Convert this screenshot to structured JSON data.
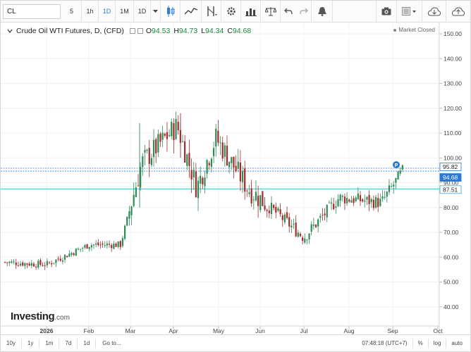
{
  "toolbar": {
    "symbol": "CL",
    "intervals": [
      "5",
      "1h",
      "1D",
      "1M",
      "1D"
    ],
    "active_interval": 2,
    "icons": [
      "dropdown-icon",
      "candles-icon",
      "indicators-icon",
      "drawing-tool-icon",
      "settings-icon",
      "chart-template-icon",
      "balance-icon",
      "undo-icon",
      "redo-icon",
      "alert-icon",
      "camera-icon",
      "window-layout-icon",
      "cloud-load-icon",
      "cloud-save-icon"
    ]
  },
  "legend": {
    "title": "Crude Oil WTI Futures, D, (CFD)",
    "o_label": "O",
    "o": "94.53",
    "h_label": "H",
    "h": "94.73",
    "l_label": "L",
    "l": "94.34",
    "c_label": "C",
    "c": "94.68",
    "status": "Market Closed"
  },
  "axis": {
    "y_ticks": [
      "150.00",
      "140.00",
      "130.00",
      "120.00",
      "110.00",
      "100.00",
      "90.00",
      "80.00",
      "70.00",
      "60.00",
      "50.00",
      "40.00"
    ],
    "x_ticks": [
      "2026",
      "Feb",
      "Mar",
      "Apr",
      "May",
      "Jun",
      "Jul",
      "Aug",
      "Sep",
      "Oct"
    ],
    "price_labels": [
      {
        "text": "95.82",
        "color": "#2b79d1"
      },
      {
        "text": "94.68",
        "color": "#2b79d1"
      },
      {
        "text": "87.51",
        "color": "#3aa5d2"
      }
    ]
  },
  "brand": {
    "name": "Investing",
    "domain": ".com"
  },
  "footer": {
    "ranges": [
      "10y",
      "1y",
      "1m",
      "7d",
      "1d"
    ],
    "goto": "Go to...",
    "time": "07:48:18 (UTC+7)",
    "pct": "%",
    "log": "log",
    "auto": "auto"
  },
  "colors": {
    "up": "#2e8b57",
    "down": "#a52a2a",
    "line1": "#2b79d1",
    "line2": "#3aa5d2"
  },
  "chart_data": {
    "type": "candlestick",
    "title": "Crude Oil WTI Futures, D, (CFD)",
    "ylim": [
      32,
      152
    ],
    "hlines": [
      95.82,
      94.68,
      87.51
    ],
    "last": {
      "open": 94.53,
      "high": 94.73,
      "low": 94.34,
      "close": 94.68
    },
    "anchors": [
      {
        "date": "Dec 2025",
        "close": 58
      },
      {
        "date": "Jan 2026",
        "close": 57
      },
      {
        "date": "Feb",
        "close": 65
      },
      {
        "date": "Mar",
        "close": 65
      },
      {
        "date": "Mar",
        "close": 98
      },
      {
        "date": "Apr",
        "close": 113
      },
      {
        "date": "May",
        "close": 88
      },
      {
        "date": "May",
        "close": 108
      },
      {
        "date": "Jun",
        "close": 88
      },
      {
        "date": "Jul",
        "close": 68
      },
      {
        "date": "Aug",
        "close": 84
      },
      {
        "date": "Aug",
        "close": 82
      },
      {
        "date": "Sep",
        "close": 94.68
      }
    ]
  }
}
